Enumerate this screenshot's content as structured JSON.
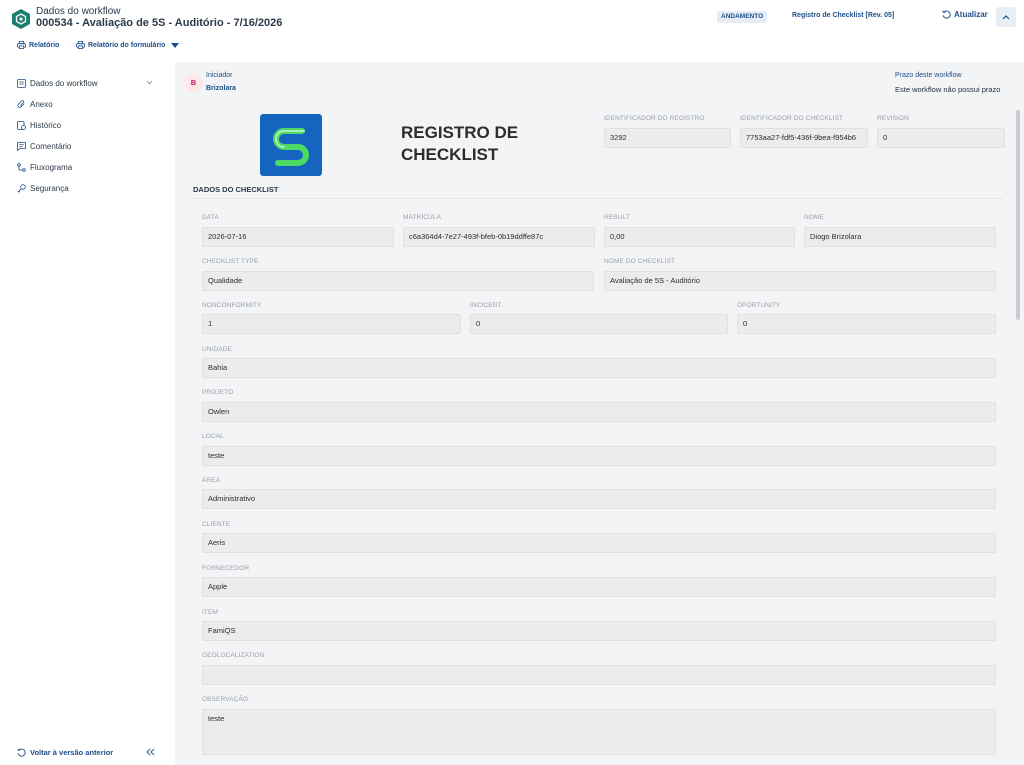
{
  "header": {
    "label": "Dados do workflow",
    "title": "000534 - Avaliação de 5S - Auditório - 7/16/2026",
    "status": "ANDAMENTO",
    "checklist_link": "Registro de Checklist [Rev. 05]",
    "refresh_label": "Atualizar"
  },
  "toolbar": {
    "report_label": "Relatório",
    "form_report_label": "Relatório do formulário"
  },
  "sidebar": {
    "items": [
      {
        "label": "Dados do workflow"
      },
      {
        "label": "Anexo"
      },
      {
        "label": "Histórico"
      },
      {
        "label": "Comentário"
      },
      {
        "label": "Fluxograma"
      },
      {
        "label": "Segurança"
      }
    ],
    "footer_label": "Voltar à versão anterior"
  },
  "initiator": {
    "avatar_letter": "B",
    "label": "Iniciador",
    "name": "Brizolara"
  },
  "deadline": {
    "label": "Prazo deste workflow",
    "value": "Este workflow não possui prazo"
  },
  "form": {
    "title": "REGISTRO DE CHECKLIST",
    "section_title": "DADOS DO CHECKLIST",
    "fields": {
      "registro_id": {
        "label": "IDENTIFICADOR DO REGISTRO",
        "value": "3292"
      },
      "checklist_id": {
        "label": "IDENTIFICADOR DO CHECKLIST",
        "value": "7753aa27-fdf5-436f-9bea-f954b6"
      },
      "revision": {
        "label": "REVISION",
        "value": "0"
      },
      "data": {
        "label": "DATA",
        "value": "2026-07-16"
      },
      "matricula": {
        "label": "MATRÍCULA",
        "value": "c6a364d4-7e27-493f-bfeb-0b19ddffe87c"
      },
      "result": {
        "label": "RESULT",
        "value": "0,00"
      },
      "nome": {
        "label": "NOME",
        "value": "Diogo Brizolara"
      },
      "checklist_type": {
        "label": "CHECKLIST TYPE",
        "value": "Qualidade"
      },
      "nome_checklist": {
        "label": "NOME DO CHECKLIST",
        "value": "Avaliação de 5S - Auditório"
      },
      "nonconformity": {
        "label": "NONCONFORMITY",
        "value": "1"
      },
      "incicent": {
        "label": "INCICENT",
        "value": "0"
      },
      "oportunity": {
        "label": "OPORTUNITY",
        "value": "0"
      },
      "unidade": {
        "label": "UNIDADE",
        "value": "Bahia"
      },
      "projeto": {
        "label": "PROJETO",
        "value": "Owlen"
      },
      "local": {
        "label": "LOCAL",
        "value": "teste"
      },
      "area": {
        "label": "ÁREA",
        "value": "Administrativo"
      },
      "cliente": {
        "label": "CLIENTE",
        "value": "Aeris"
      },
      "fornecedor": {
        "label": "FORNECEDOR",
        "value": "Apple"
      },
      "item": {
        "label": "ITEM",
        "value": "FamiQS"
      },
      "geolocalization": {
        "label": "GEOLOCALIZATION",
        "value": ""
      },
      "observacao": {
        "label": "OBSERVAÇÃO",
        "value": "teste"
      }
    }
  },
  "colors": {
    "accent": "#1d4e89",
    "app_logo": "#1a7f6e",
    "brand_logo_bg": "#1565c0",
    "brand_logo_stroke": "#4cd964"
  }
}
